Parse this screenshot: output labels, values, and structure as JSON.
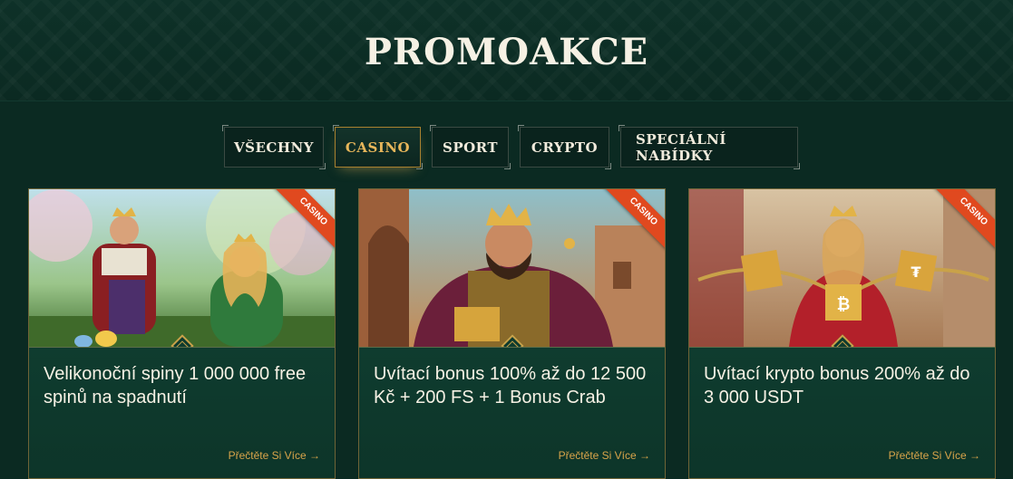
{
  "page": {
    "title": "PROMOAKCE"
  },
  "tabs": [
    {
      "label": "VŠECHNY",
      "active": false
    },
    {
      "label": "CASINO",
      "active": true
    },
    {
      "label": "SPORT",
      "active": false
    },
    {
      "label": "CRYPTO",
      "active": false
    },
    {
      "label": "SPECIÁLNÍ NABÍDKY",
      "active": false
    }
  ],
  "cards": [
    {
      "badge": "CASINO",
      "title": "Velikonoční spiny 1 000 000 free spinů na spadnutí",
      "link": "Přečtěte Si Více →"
    },
    {
      "badge": "CASINO",
      "title": "Uvítací bonus 100% až do 12 500 Kč + 200 FS + 1 Bonus Crab",
      "link": "Přečtěte Si Více →"
    },
    {
      "badge": "CASINO",
      "title": "Uvítací krypto bonus 200% až do 3 000 USDT",
      "link": "Přečtěte Si Více →"
    }
  ],
  "colors": {
    "background": "#0b2a22",
    "accent": "#e7b65a",
    "badge": "#e0491f",
    "card": "#0f3b2e"
  }
}
